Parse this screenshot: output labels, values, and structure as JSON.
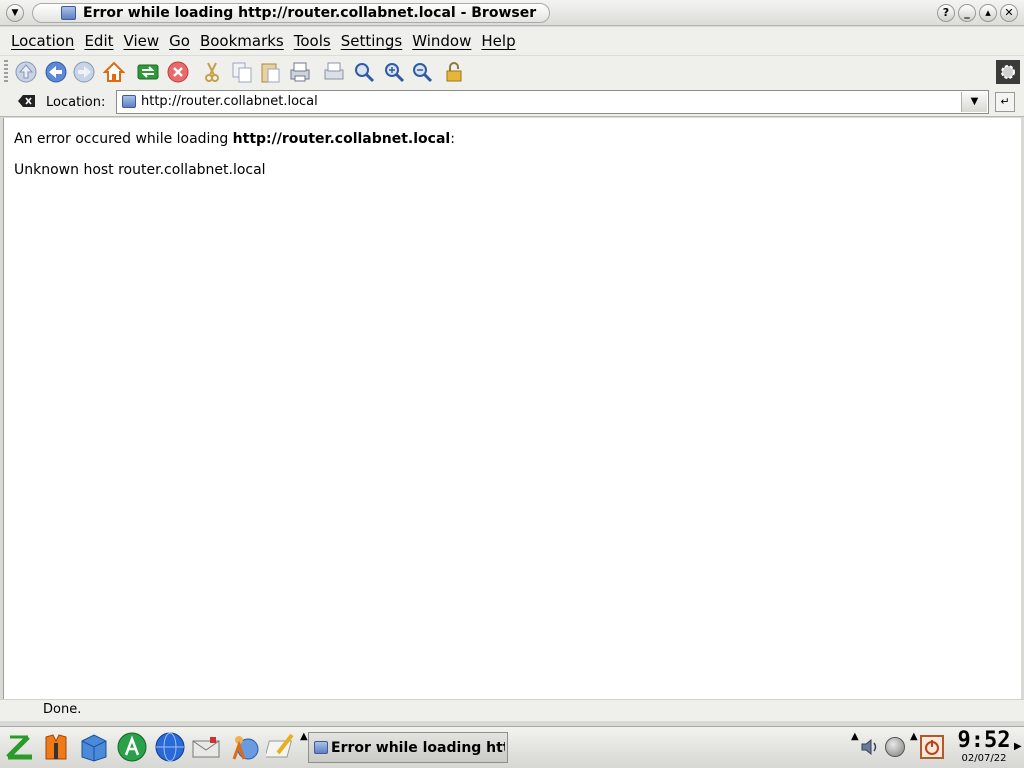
{
  "window": {
    "title": "Error while loading http://router.collabnet.local - Browser",
    "buttons": [
      "?",
      "_",
      "▴",
      "✕"
    ]
  },
  "menubar": {
    "items": [
      "Location",
      "Edit",
      "View",
      "Go",
      "Bookmarks",
      "Tools",
      "Settings",
      "Window",
      "Help"
    ]
  },
  "toolbar": {
    "icons": [
      "up-icon",
      "back-icon",
      "forward-icon",
      "home-icon",
      "reload-icon",
      "stop-icon",
      "cut-icon",
      "copy-icon",
      "paste-icon",
      "print-icon",
      "print-frame-icon",
      "zoom-icon",
      "zoom-in-icon",
      "zoom-out-icon",
      "security-lock-icon"
    ]
  },
  "location": {
    "label": "Location:",
    "url": "http://router.collabnet.local"
  },
  "content": {
    "error_prefix": "An error occured while loading ",
    "error_url": "http://router.collabnet.local",
    "error_suffix": ":",
    "detail": "Unknown host router.collabnet.local"
  },
  "status": {
    "text": "Done."
  },
  "taskbar": {
    "task_label": "Error while loading http://router.collabnet.local - Browser",
    "clock_time": "9:52",
    "clock_date": "02/07/22"
  },
  "colors": {
    "chrome": "#efefec",
    "content_bg": "#ffffff",
    "stop_red": "#e04040",
    "home_orange": "#e06a10"
  }
}
